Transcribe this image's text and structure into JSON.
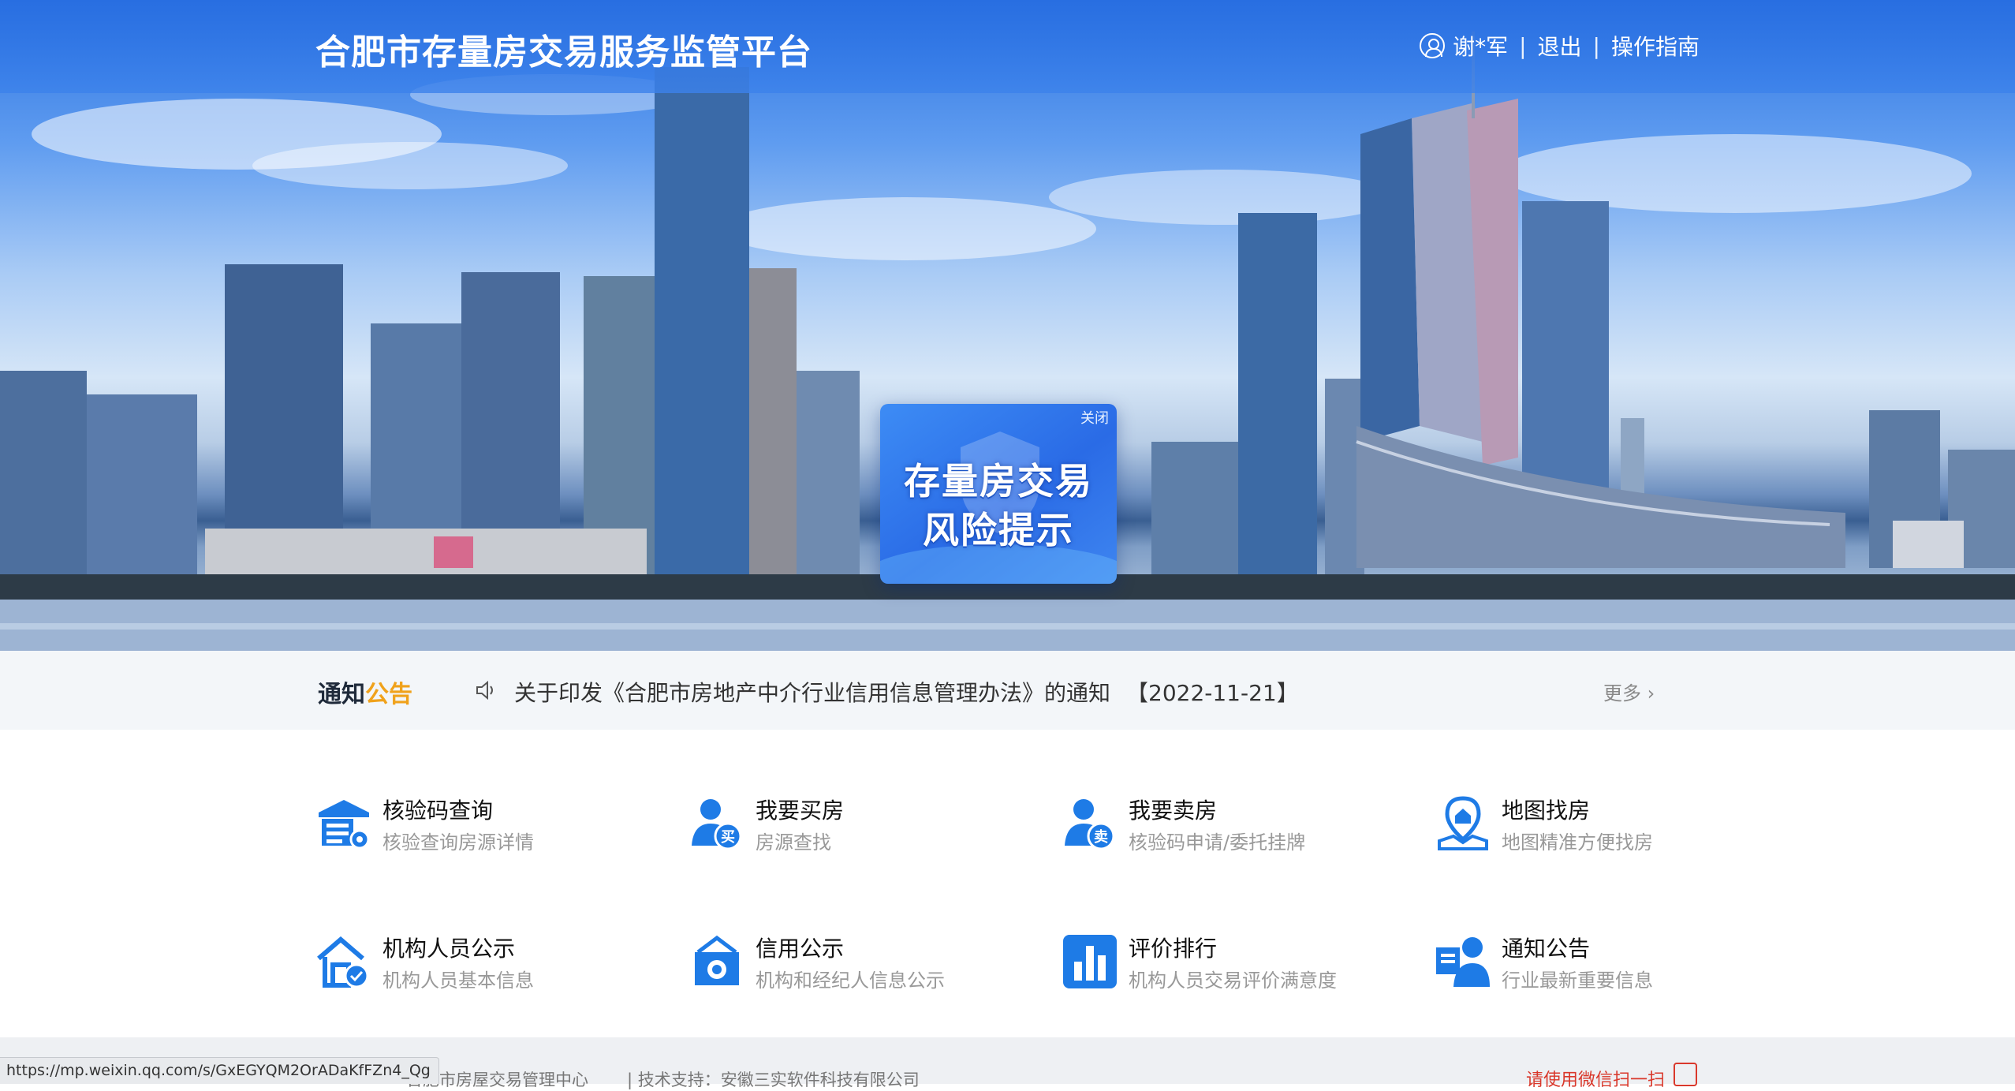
{
  "header": {
    "title": "合肥市存量房交易服务监管平台",
    "user_name": "谢*军",
    "logout_label": "退出",
    "guide_label": "操作指南",
    "separator": "|"
  },
  "risk_popup": {
    "close_label": "关闭",
    "line1": "存量房交易",
    "line2": "风险提示"
  },
  "notice": {
    "title_part1": "通知",
    "title_part2": "公告",
    "text": "关于印发《合肥市房地产中介行业信用信息管理办法》的通知",
    "date": "【2022-11-21】",
    "more_label": "更多 ›"
  },
  "services": [
    {
      "title": "核验码查询",
      "desc": "核验查询房源详情",
      "icon": "building-gear-icon"
    },
    {
      "title": "我要买房",
      "desc": "房源查找",
      "icon": "user-buy-icon",
      "badge": "买"
    },
    {
      "title": "我要卖房",
      "desc": "核验码申请/委托挂牌",
      "icon": "user-sell-icon",
      "badge": "卖"
    },
    {
      "title": "地图找房",
      "desc": "地图精准方便找房",
      "icon": "map-pin-house-icon"
    },
    {
      "title": "机构人员公示",
      "desc": "机构人员基本信息",
      "icon": "house-check-icon"
    },
    {
      "title": "信用公示",
      "desc": "机构和经纪人信息公示",
      "icon": "credit-medal-icon"
    },
    {
      "title": "评价排行",
      "desc": "机构人员交易评价满意度",
      "icon": "bar-chart-icon"
    },
    {
      "title": "通知公告",
      "desc": "行业最新重要信息",
      "icon": "announcer-icon"
    }
  ],
  "footer": {
    "org_text": "合肥市房屋交易管理中心",
    "tech_text": "|    技术支持：安徽三实软件科技有限公司",
    "wechat_text": "请使用微信扫一扫"
  },
  "status_bar": {
    "url": "https://mp.weixin.qq.com/s/GxEGYQM2OrADaKfFZn4_Qg"
  },
  "colors": {
    "brand_blue": "#2a6be6",
    "icon_blue": "#1e7be6",
    "notice_accent": "#f0a21b",
    "footer_red": "#d9382b"
  }
}
